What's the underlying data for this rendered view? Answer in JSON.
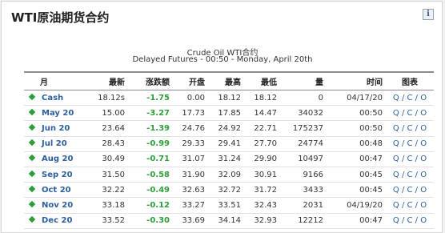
{
  "panel": {
    "title": "WTI原油期货合约",
    "info_label": "i"
  },
  "chart_header": {
    "line1": "Crude Oil WTI合约",
    "line2": "Delayed Futures - 00:50 - Monday, April 20th"
  },
  "table": {
    "headers": {
      "month": "月",
      "last": "最新",
      "change": "涨跌额",
      "open": "开盘",
      "high": "最高",
      "low": "最低",
      "volume": "量",
      "time": "时间",
      "chart": "图表"
    },
    "rows": [
      {
        "month": "Cash",
        "last": "18.12s",
        "change": "-1.75",
        "open": "0.00",
        "high": "18.12",
        "low": "18.12",
        "volume": "0",
        "time": "04/17/20",
        "q": "Q",
        "sep1": "/",
        "c": "C",
        "sep2": "/",
        "o": "O"
      },
      {
        "month": "May 20",
        "last": "15.00",
        "change": "-3.27",
        "open": "17.73",
        "high": "17.85",
        "low": "14.47",
        "volume": "34032",
        "time": "00:50",
        "q": "Q",
        "sep1": "/",
        "c": "C",
        "sep2": "/",
        "o": "O"
      },
      {
        "month": "Jun 20",
        "last": "23.64",
        "change": "-1.39",
        "open": "24.76",
        "high": "24.92",
        "low": "22.71",
        "volume": "175237",
        "time": "00:50",
        "q": "Q",
        "sep1": "/",
        "c": "C",
        "sep2": "/",
        "o": "O"
      },
      {
        "month": "Jul 20",
        "last": "28.43",
        "change": "-0.99",
        "open": "29.33",
        "high": "29.41",
        "low": "27.70",
        "volume": "24774",
        "time": "00:48",
        "q": "Q",
        "sep1": "/",
        "c": "C",
        "sep2": "/",
        "o": "O"
      },
      {
        "month": "Aug 20",
        "last": "30.49",
        "change": "-0.71",
        "open": "31.07",
        "high": "31.24",
        "low": "29.90",
        "volume": "10497",
        "time": "00:47",
        "q": "Q",
        "sep1": "/",
        "c": "C",
        "sep2": "/",
        "o": "O"
      },
      {
        "month": "Sep 20",
        "last": "31.50",
        "change": "-0.58",
        "open": "31.90",
        "high": "32.09",
        "low": "30.91",
        "volume": "9166",
        "time": "00:45",
        "q": "Q",
        "sep1": "/",
        "c": "C",
        "sep2": "/",
        "o": "O"
      },
      {
        "month": "Oct 20",
        "last": "32.22",
        "change": "-0.49",
        "open": "32.63",
        "high": "32.72",
        "low": "31.72",
        "volume": "3433",
        "time": "00:45",
        "q": "Q",
        "sep1": "/",
        "c": "C",
        "sep2": "/",
        "o": "O"
      },
      {
        "month": "Nov 20",
        "last": "33.18",
        "change": "-0.12",
        "open": "33.27",
        "high": "33.51",
        "low": "32.43",
        "volume": "2031",
        "time": "04/19/20",
        "q": "Q",
        "sep1": "/",
        "c": "C",
        "sep2": "/",
        "o": "O"
      },
      {
        "month": "Dec 20",
        "last": "33.52",
        "change": "-0.30",
        "open": "33.69",
        "high": "34.14",
        "low": "32.93",
        "volume": "12212",
        "time": "00:47",
        "q": "Q",
        "sep1": "/",
        "c": "C",
        "sep2": "/",
        "o": "O"
      }
    ]
  },
  "colors": {
    "link_blue": "#2d5f9e",
    "change_green": "#2e9e3a",
    "marker_green": "#2e9e3a"
  }
}
